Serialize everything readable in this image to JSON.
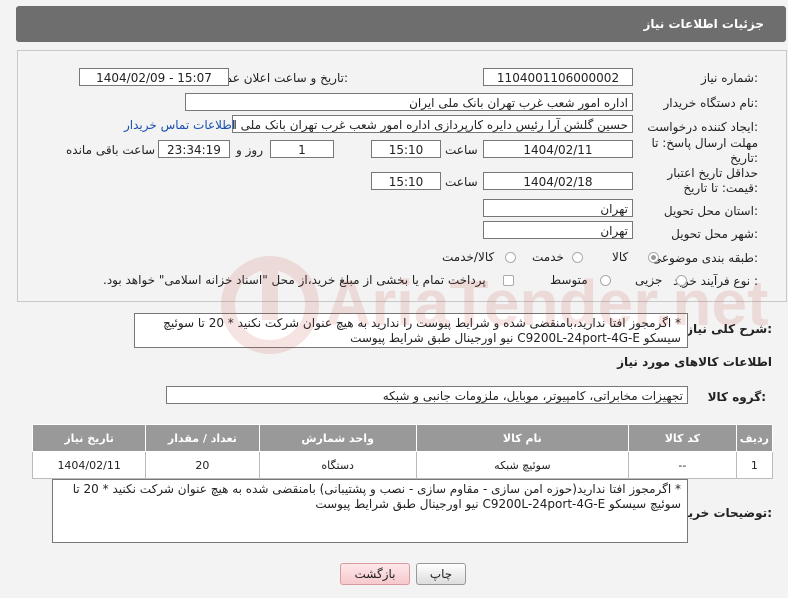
{
  "header": {
    "title": "جزئیات اطلاعات نیاز"
  },
  "form": {
    "need_number_label": "شماره نیاز:",
    "need_number": "1104001106000002",
    "announce_label": "تاریخ و ساعت اعلان عمومی:",
    "announce_value": "1404/02/09 - 15:07",
    "buyer_org_label": "نام دستگاه خریدار:",
    "buyer_org": "اداره امور شعب غرب تهران بانک ملی ایران",
    "requester_label": "ایجاد کننده درخواست:",
    "requester": "حسین گلشن آرا رئیس دایره کارپردازی اداره امور شعب غرب تهران بانک ملی ایران",
    "contact_link": "اطلاعات تماس خریدار",
    "deadline_label": "مهلت ارسال پاسخ: تا تاریخ:",
    "deadline_date": "1404/02/11",
    "time_label": "ساعت",
    "deadline_time": "15:10",
    "day_value": "1",
    "day_label": "روز و",
    "remaining_time": "23:34:19",
    "remaining_label": "ساعت باقی مانده",
    "validity_label": "حداقل تاریخ اعتبار قیمت: تا تاریخ:",
    "validity_date": "1404/02/18",
    "validity_time": "15:10",
    "province_label": "استان محل تحویل:",
    "province": "تهران",
    "city_label": "شهر محل تحویل:",
    "city": "تهران",
    "category_label": "طبقه بندی موضوعی:",
    "category_options": [
      "کالا",
      "خدمت",
      "کالا/خدمت"
    ],
    "process_label": "نوع فرآیند خرید :",
    "process_options": [
      "جزیی",
      "متوسط"
    ],
    "payment_note": "پرداخت تمام یا بخشی از مبلغ خرید،از محل \"اسناد خزانه اسلامی\" خواهد بود."
  },
  "description": {
    "label": "شرح کلی نیاز:",
    "text": "* اگرمجوز افتا ندارید،بامنقضی شده و شرایط پیوست را ندارید به هیچ عنوان شرکت نکنید * 20 تا سوئیچ سیسکو C9200L-24port-4G-E نیو اورجینال طبق شرایط پیوست"
  },
  "goods_info": {
    "title": "اطلاعات کالاهای مورد نیاز",
    "group_label": "گروه کالا:",
    "group_value": "تجهیزات مخابراتی، کامپیوتر، موبایل، ملزومات جانبی و شبکه"
  },
  "table": {
    "headers": [
      "ردیف",
      "کد کالا",
      "نام کالا",
      "واحد شمارش",
      "تعداد / مقدار",
      "تاریخ نیاز"
    ],
    "rows": [
      [
        "1",
        "--",
        "سوئیچ شبکه",
        "دستگاه",
        "20",
        "1404/02/11"
      ]
    ]
  },
  "buyer_notes": {
    "label": "توضیحات خریدار:",
    "text": "* اگرمجوز افتا ندارید(حوزه امن سازی - مقاوم سازی - نصب و پشتیبانی) بامنقضی شده به هیچ عنوان شرکت نکنید * 20 تا سوئیچ سیسکو C9200L-24port-4G-E نیو اورجینال طبق شرایط پیوست"
  },
  "buttons": {
    "print": "چاپ",
    "back": "بازگشت"
  },
  "watermark": {
    "text": "AriaTender.net"
  }
}
